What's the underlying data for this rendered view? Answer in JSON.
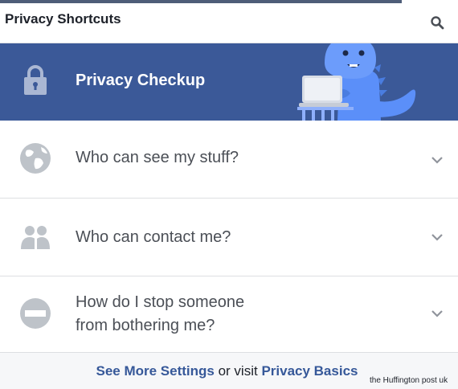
{
  "header": {
    "title": "Privacy Shortcuts",
    "search_icon": "search-icon"
  },
  "checkup": {
    "label": "Privacy Checkup",
    "icon": "lock-icon",
    "illustration": "dinosaur-with-laptop"
  },
  "items": [
    {
      "label": "Who can see my stuff?",
      "icon": "globe-icon"
    },
    {
      "label": "Who can contact me?",
      "icon": "people-icon"
    },
    {
      "label_line1": "How do I stop someone",
      "label_line2": "from bothering me?",
      "icon": "block-icon"
    }
  ],
  "footer": {
    "link1": "See More Settings",
    "middle": " or visit ",
    "link2": "Privacy Basics"
  },
  "watermark": "the Huffington post uk",
  "colors": {
    "brand_blue": "#3b5998",
    "link_blue": "#365899",
    "dino_blue": "#5b8ff9",
    "icon_gray": "#bec3c9"
  }
}
